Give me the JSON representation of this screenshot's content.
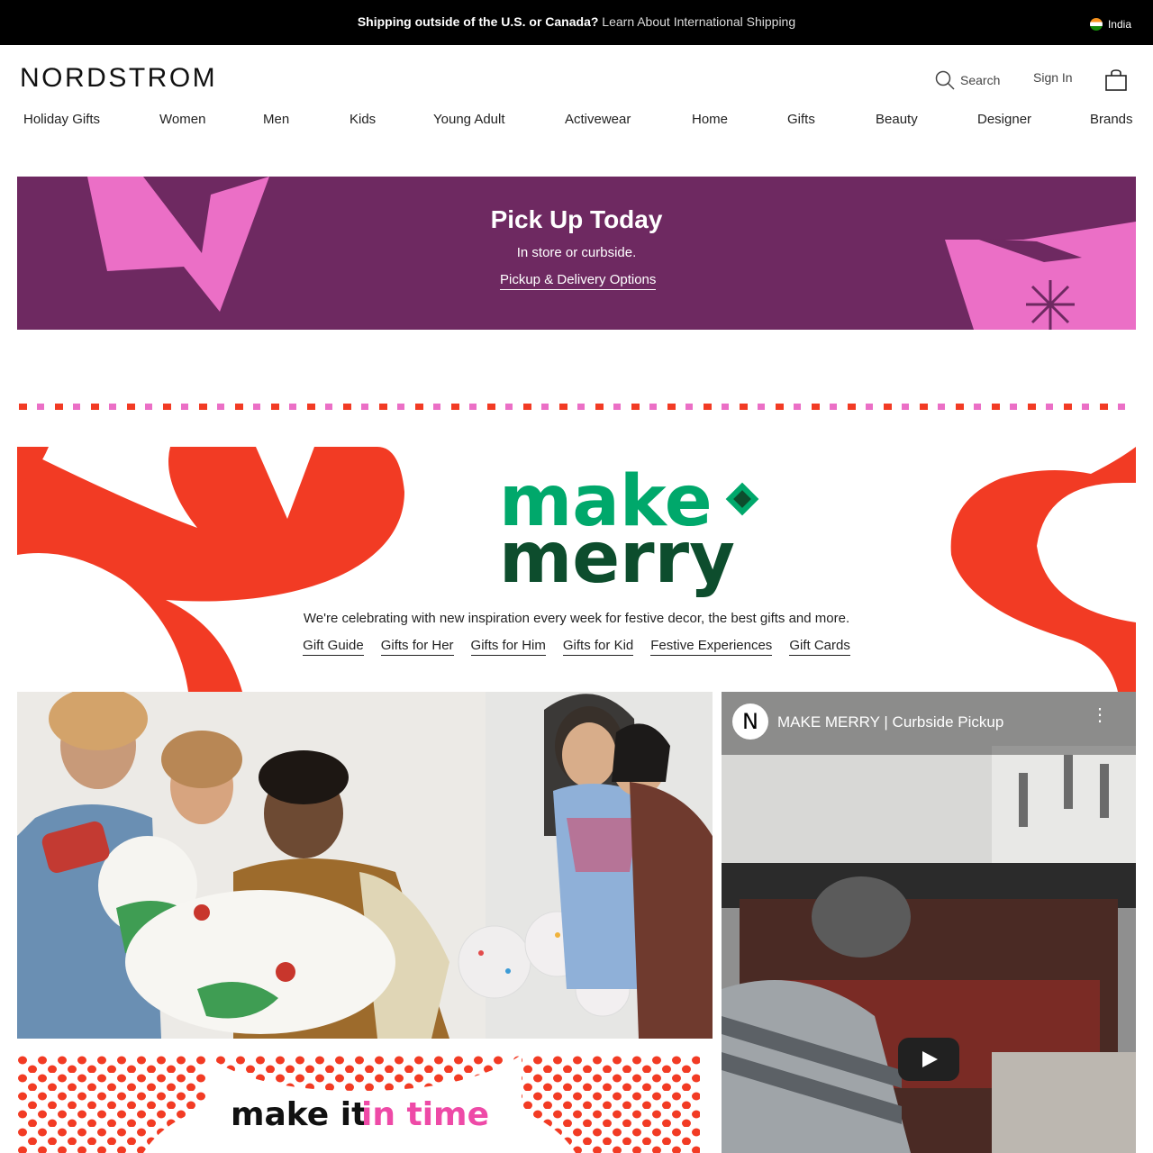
{
  "topbar": {
    "message_bold": "Shipping outside of the U.S. or Canada?",
    "message_link": "Learn About International Shipping",
    "country": "India"
  },
  "header": {
    "logo": "NORDSTROM",
    "search_label": "Search",
    "signin_label": "Sign In"
  },
  "nav": {
    "items": [
      "Holiday Gifts",
      "Women",
      "Men",
      "Kids",
      "Young Adult",
      "Activewear",
      "Home",
      "Gifts",
      "Beauty",
      "Designer",
      "Brands"
    ]
  },
  "pickup": {
    "title": "Pick Up Today",
    "subtitle": "In store or curbside.",
    "link": "Pickup & Delivery Options"
  },
  "merry": {
    "logo_line1": "make",
    "logo_line2": "merry",
    "description": "We're celebrating with new inspiration every week for festive decor, the best gifts and more.",
    "links": [
      "Gift Guide",
      "Gifts for Her",
      "Gifts for Him",
      "Gifts for Kid",
      "Festive Experiences",
      "Gift Cards"
    ]
  },
  "intime": {
    "text_dark": "make it",
    "text_pink": "in time"
  },
  "video": {
    "channel_letter": "N",
    "title": "MAKE MERRY | Curbside Pickup"
  },
  "colors": {
    "pickup_bg": "#6e2961",
    "pickup_shape": "#eb6fc6",
    "merry_red": "#f23b24",
    "merry_green": "#00a86b",
    "merry_dark_green": "#0d4d2d",
    "intime_pink": "#ee4aa7"
  }
}
